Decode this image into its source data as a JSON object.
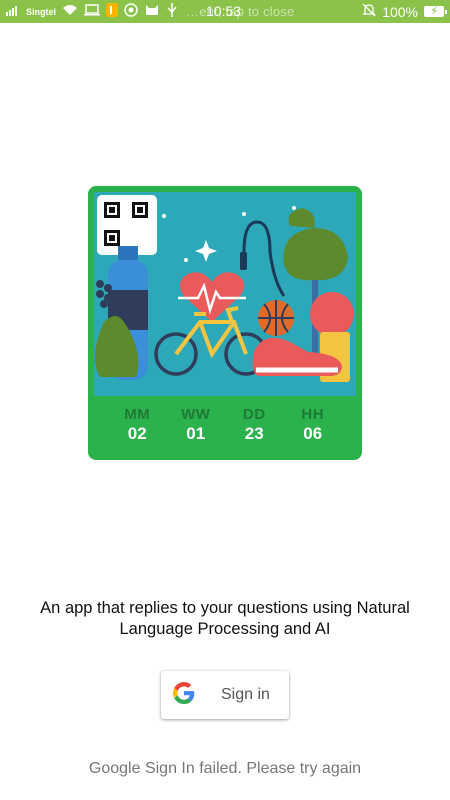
{
  "status_bar": {
    "carrier": "Singtel",
    "time": "10:53",
    "overlay_text": "…ent, tap to close",
    "battery": "100%",
    "icons": [
      "signal-icon",
      "wifi-icon",
      "laptop-icon",
      "notification-icon",
      "whatsapp-icon",
      "cat-icon",
      "usb-icon",
      "mute-icon",
      "battery-icon"
    ]
  },
  "timer": {
    "labels": [
      "MM",
      "WW",
      "DD",
      "HH"
    ],
    "values": [
      "02",
      "01",
      "23",
      "06"
    ]
  },
  "description": "An app that replies to your questions using Natural Language Processing and AI",
  "signin": {
    "label": "Sign in",
    "icon": "google-g-icon"
  },
  "error_message": "Google Sign In failed. Please try again",
  "colors": {
    "status_bar": "#8bc34a",
    "card_green": "#2bb24c",
    "art_bg": "#2da8b8"
  }
}
